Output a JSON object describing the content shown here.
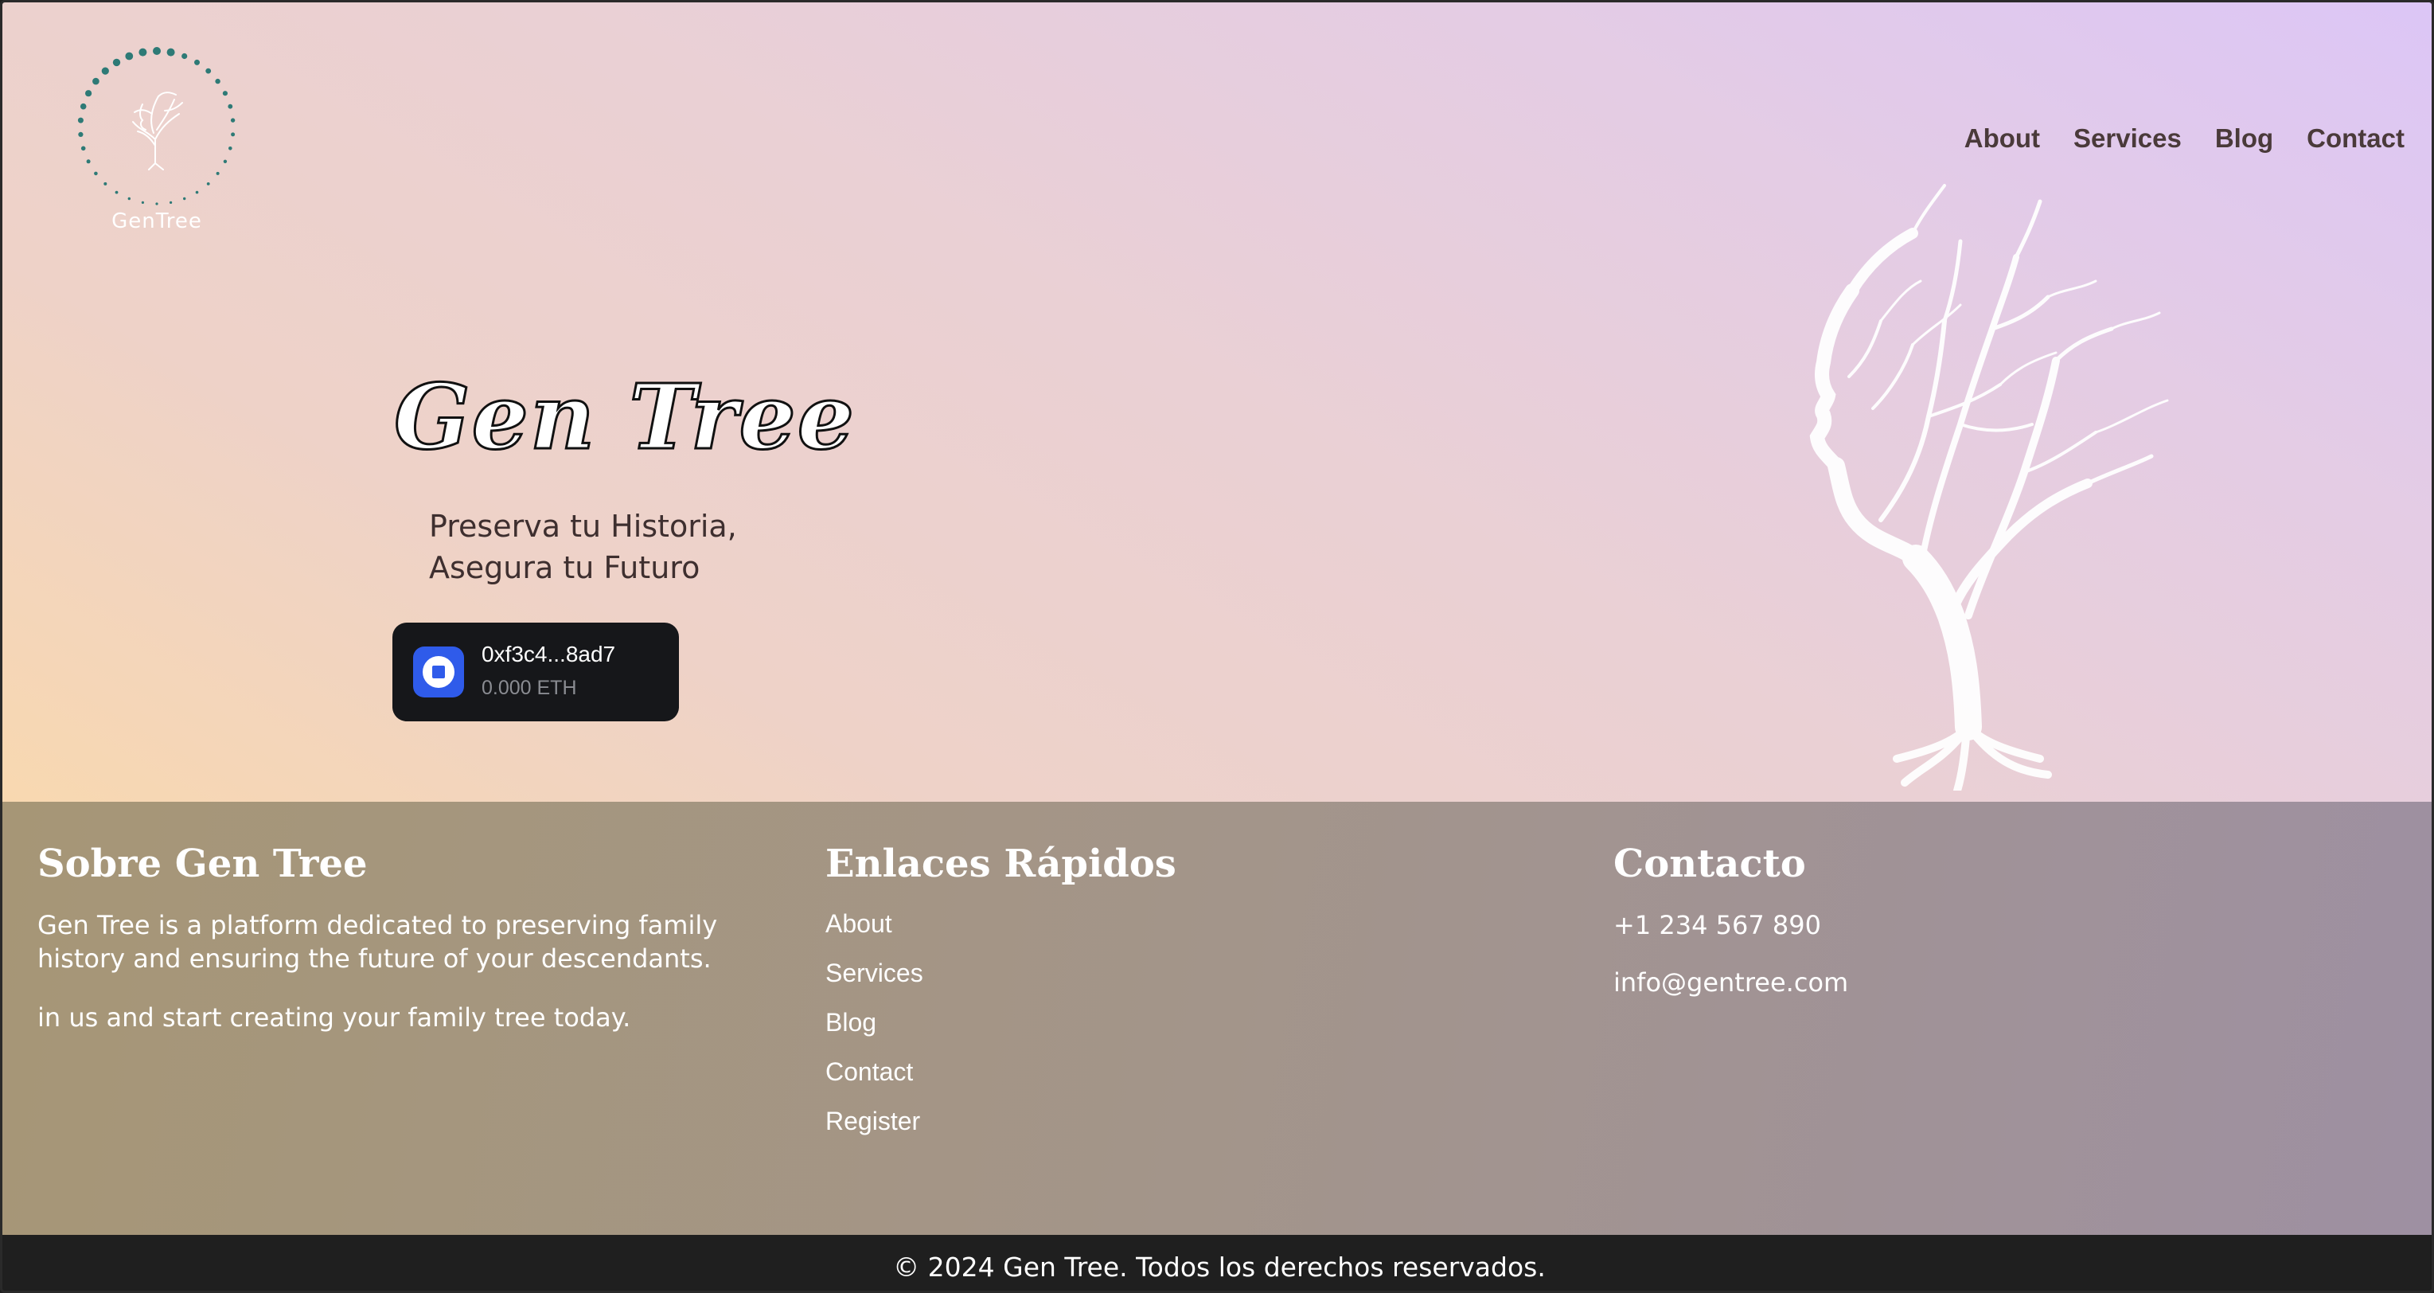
{
  "brand": {
    "logo_text": "GenTree"
  },
  "nav": {
    "items": [
      "About",
      "Services",
      "Blog",
      "Contact"
    ]
  },
  "hero": {
    "title": "Gen Tree",
    "subtitle_line1": "Preserva tu Historia,",
    "subtitle_line2": "Asegura tu Futuro"
  },
  "wallet": {
    "address": "0xf3c4...8ad7",
    "balance": "0.000 ETH",
    "icon": "wallet-icon"
  },
  "footer": {
    "about": {
      "title": "Sobre Gen Tree",
      "text1": "Gen Tree is a platform dedicated to preserving family history and ensuring the future of your descendants.",
      "text2": "in us and start creating your family tree today."
    },
    "links": {
      "title": "Enlaces Rápidos",
      "items": [
        "About",
        "Services",
        "Blog",
        "Contact",
        "Register"
      ]
    },
    "contact": {
      "title": "Contacto",
      "phone": "+1 234 567 890",
      "email": "info@gentree.com"
    },
    "copyright": "© 2024 Gen Tree. Todos los derechos reservados."
  },
  "colors": {
    "gradient_start": "#f8d8b0",
    "gradient_end": "#dcc6f6",
    "wallet_bg": "#16171a",
    "wallet_accent": "#2f5bea",
    "logo_dots": "#2e7a76"
  }
}
